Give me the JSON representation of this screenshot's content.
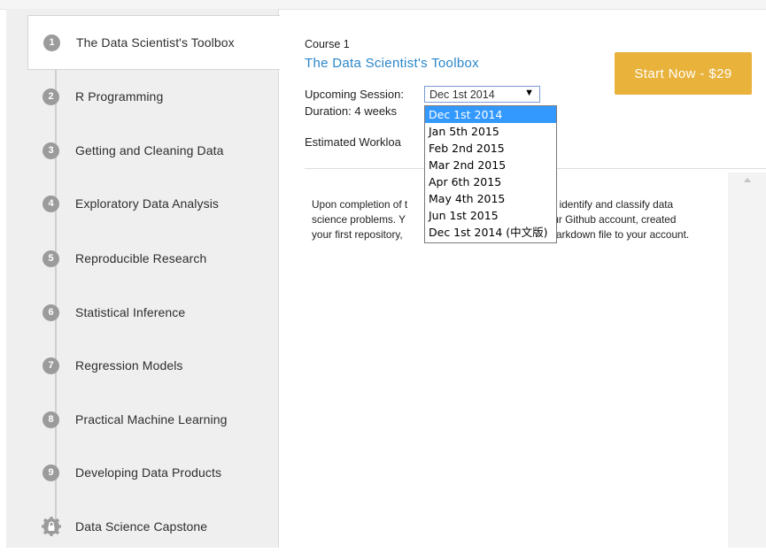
{
  "sidebar": {
    "items": [
      {
        "num": "1",
        "label": "The Data Scientist's Toolbox"
      },
      {
        "num": "2",
        "label": "R Programming"
      },
      {
        "num": "3",
        "label": "Getting and Cleaning Data"
      },
      {
        "num": "4",
        "label": "Exploratory Data Analysis"
      },
      {
        "num": "5",
        "label": "Reproducible Research"
      },
      {
        "num": "6",
        "label": "Statistical Inference"
      },
      {
        "num": "7",
        "label": "Regression Models"
      },
      {
        "num": "8",
        "label": "Practical Machine Learning"
      },
      {
        "num": "9",
        "label": "Developing Data Products"
      },
      {
        "num": "",
        "label": "Data Science Capstone",
        "icon": "lock-gear-icon"
      }
    ]
  },
  "course": {
    "number_label": "Course 1",
    "title": "The Data Scientist's Toolbox",
    "start_button": "Start Now - $29",
    "session_label": "Upcoming Session:",
    "session_value": "Dec 1st 2014",
    "duration_label": "Duration: 4 weeks",
    "workload_label": "Estimated Workloa"
  },
  "dropdown": {
    "options": [
      "Dec 1st 2014",
      "Jan 5th 2015",
      "Feb 2nd 2015",
      "Mar 2nd 2015",
      "Apr 6th 2015",
      "May 4th 2015",
      "Jun 1st 2015",
      "Dec 1st 2014 (中文版)"
    ],
    "selected_index": 0
  },
  "description": {
    "line1_left": "Upon completion of t",
    "line1_right": "le to identify and classify data",
    "line2_left": "science problems. Y",
    "line2_right": "l your Github account, created",
    "line3_left": "your first repository,",
    "line3_right": "arkdown file to your account."
  },
  "colors": {
    "accent": "#2a86c9",
    "button": "#e8b23b",
    "dropdown_highlight": "#3399ff"
  }
}
